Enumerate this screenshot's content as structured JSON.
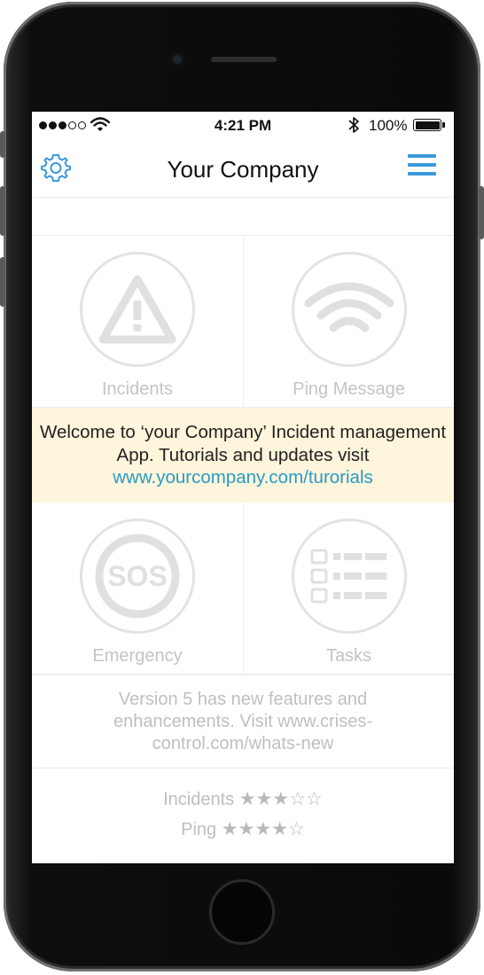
{
  "status_bar": {
    "time": "4:21 PM",
    "battery_percent": "100%",
    "signal_bars_filled": 3,
    "signal_bars_total": 5,
    "icons": [
      "signal-dots-icon",
      "wifi-icon",
      "bluetooth-icon",
      "battery-icon"
    ]
  },
  "header": {
    "title": "Your Company",
    "left_icon": "gear-icon",
    "right_icon": "hamburger-menu-icon",
    "accent_color": "#3b9ad9"
  },
  "tiles": [
    {
      "label": "Incidents",
      "icon": "warning-triangle-icon"
    },
    {
      "label": "Ping Message",
      "icon": "wifi-signal-icon"
    },
    {
      "label": "Emergency",
      "icon": "sos-icon"
    },
    {
      "label": "Tasks",
      "icon": "checklist-icon"
    }
  ],
  "banner": {
    "text": "Welcome to ‘your Company’ Incident management App. Tutorials and updates visit",
    "link": "www.yourcompany.com/turorials",
    "background": "#fdf5dc",
    "link_color": "#2a9ac6"
  },
  "version_notice": "Version 5 has new features and enhancements. Visit www.crises-control.com/whats-new",
  "ratings": [
    {
      "label": "Incidents",
      "stars": "★★★☆☆",
      "value": 3,
      "max": 5
    },
    {
      "label": "Ping",
      "stars": "★★★★☆",
      "value": 4,
      "max": 5
    }
  ]
}
